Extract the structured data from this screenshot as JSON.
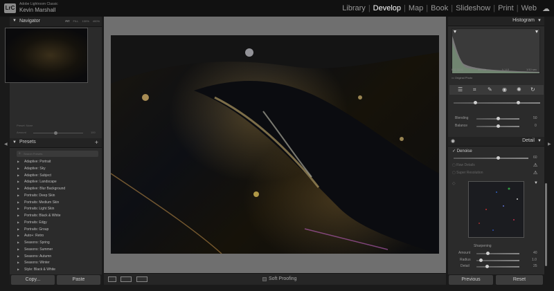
{
  "app": {
    "logo": "LrC",
    "name": "Adobe Lightroom Classic",
    "user": "Kevin Marshall"
  },
  "modules": [
    "Library",
    "Develop",
    "Map",
    "Book",
    "Slideshow",
    "Print",
    "Web"
  ],
  "active_module": "Develop",
  "navigator": {
    "title": "Navigator",
    "options": [
      "FIT",
      "FILL",
      "100%",
      "400%"
    ],
    "selected_option": "FIT"
  },
  "preset_amount": {
    "preset_label": "Preset: None",
    "amount_label": "Amount",
    "amount_value": "100"
  },
  "presets": {
    "title": "Presets",
    "search_placeholder": "Search Presets",
    "items": [
      "Adaptive: Portrait",
      "Adaptive: Sky",
      "Adaptive: Subject",
      "Adaptive: Landscape",
      "Adaptive: Blur Background",
      "Portraits: Deep Skin",
      "Portraits: Medium Skin",
      "Portraits: Light Skin",
      "Portraits: Black & White",
      "Portraits: Edgy",
      "Portraits: Group",
      "Auto+: Retro",
      "Seasons: Spring",
      "Seasons: Summer",
      "Seasons: Autumn",
      "Seasons: Winter",
      "Style: Black & White"
    ]
  },
  "left_buttons": {
    "copy": "Copy...",
    "paste": "Paste"
  },
  "toolbar": {
    "soft_proofing": "Soft Proofing"
  },
  "histogram": {
    "title": "Histogram",
    "iso": "ISO 3200",
    "focal": "40 mm",
    "aperture": "f / 4.0",
    "shutter": "1/10 sec",
    "original_photo": "Original Photo"
  },
  "sliders_top": [
    {
      "label": "Blending",
      "value": "50",
      "frac": 0.5
    },
    {
      "label": "Balance",
      "value": "0",
      "frac": 0.5
    }
  ],
  "detail": {
    "title": "Detail",
    "denoise_label": "Denoise",
    "denoise_value": "60",
    "denoise_frac": 0.6,
    "raw_details": "Raw Details",
    "super_resolution": "Super Resolution",
    "sharpening_label": "Sharpening",
    "sharpening": [
      {
        "label": "Amount",
        "value": "40",
        "frac": 0.27
      },
      {
        "label": "Radius",
        "value": "1.0",
        "frac": 0.1
      },
      {
        "label": "Detail",
        "value": "25",
        "frac": 0.25
      }
    ]
  },
  "right_buttons": {
    "previous": "Previous",
    "reset": "Reset"
  },
  "colors": {
    "active_module": "#ffffff",
    "panel_bg": "#2b2b2b",
    "canvas_bg": "#6f6f6f"
  }
}
